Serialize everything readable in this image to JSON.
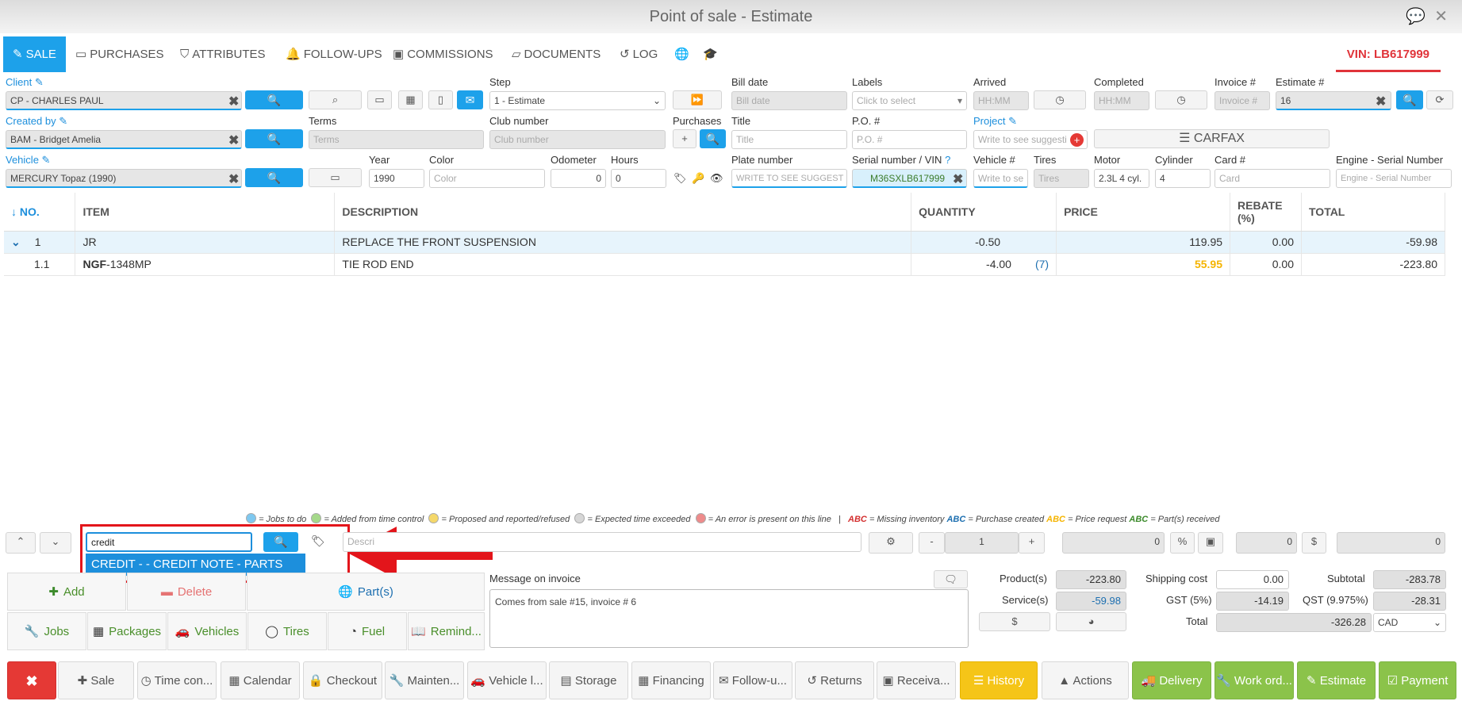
{
  "window": {
    "title": "Point of sale - Estimate"
  },
  "tabs": [
    "SALE",
    "PURCHASES",
    "ATTRIBUTES",
    "FOLLOW-UPS",
    "COMMISSIONS",
    "DOCUMENTS",
    "LOG"
  ],
  "vin_tab": "VIN: LB617999",
  "labels": {
    "client": "Client",
    "step": "Step",
    "bill_date": "Bill date",
    "labels": "Labels",
    "arrived": "Arrived",
    "completed": "Completed",
    "invoice": "Invoice #",
    "estimate": "Estimate #",
    "created_by": "Created by",
    "terms": "Terms",
    "club": "Club number",
    "purchases": "Purchases",
    "title": "Title",
    "po": "P.O. #",
    "project": "Project",
    "vehicle": "Vehicle",
    "year": "Year",
    "color": "Color",
    "odometer": "Odometer",
    "hours": "Hours",
    "plate": "Plate number",
    "serial": "Serial number / VIN",
    "vehicle_no": "Vehicle #",
    "tires": "Tires",
    "motor": "Motor",
    "cylinder": "Cylinder",
    "card": "Card #",
    "engine_serial": "Engine - Serial Number"
  },
  "fields": {
    "client": "CP - CHARLES PAUL",
    "step": "1 - Estimate",
    "bill_date_ph": "Bill date",
    "labels_ph": "Click to select",
    "arrived_ph": "HH:MM",
    "completed_ph": "HH:MM",
    "invoice_ph": "Invoice #",
    "estimate": "16",
    "created_by": "BAM - Bridget Amelia",
    "terms_ph": "Terms",
    "club_ph": "Club number",
    "title_ph": "Title",
    "po_ph": "P.O. #",
    "project_ph": "Write to see suggesti",
    "carfax": "CARFAX",
    "vehicle": "MERCURY Topaz (1990)",
    "year": "1990",
    "color_ph": "Color",
    "odometer": "0",
    "hours": "0",
    "plate_ph": "WRITE TO SEE SUGGEST",
    "serial": "M36SXLB617999",
    "vehicle_no_ph": "Write to se",
    "tires_ph": "Tires",
    "motor": "2.3L  4 cyl.",
    "cylinder": "4",
    "card_ph": "Card",
    "engine_ph": "Engine - Serial Number"
  },
  "table": {
    "headers": {
      "no": "↓ NO.",
      "item": "ITEM",
      "description": "DESCRIPTION",
      "quantity": "QUANTITY",
      "price": "PRICE",
      "rebate": "REBATE",
      "rebate2": "(%)",
      "total": "TOTAL"
    },
    "rows": [
      {
        "no": "1",
        "item": "JR",
        "item_bold": "",
        "description": "REPLACE THE FRONT SUSPENSION",
        "quantity": "-0.50",
        "qty_extra": "",
        "price": "119.95",
        "rebate": "0.00",
        "total": "-59.98"
      },
      {
        "no": "1.1",
        "item": "-1348MP",
        "item_bold": "NGF",
        "description": "TIE ROD END",
        "quantity": "-4.00",
        "qty_extra": "(7)",
        "price": "55.95",
        "rebate": "0.00",
        "total": "-223.80"
      }
    ]
  },
  "legend": {
    "jobs": "= Jobs to do",
    "added": "= Added from time control",
    "proposed": "= Proposed and reported/refused",
    "expected": "= Expected time exceeded",
    "error": "= An error is present on this line",
    "sep": "|",
    "abc": "ABC",
    "missing": "= Missing inventory",
    "purchase": "= Purchase created",
    "price_req": "= Price request",
    "received": "= Part(s) received",
    "colors": {
      "jobs": "#7ec8f0",
      "added": "#a5d98a",
      "proposed": "#f5d86a",
      "expected": "#d6d6d6",
      "error": "#ee8b8b"
    }
  },
  "entry": {
    "search_value": "credit",
    "suggestion": "CREDIT - - CREDIT NOTE - PARTS",
    "desc_ph": "Descri",
    "qty": "1",
    "price": "0",
    "rebate": "0",
    "total": "0",
    "minus": "-",
    "plus": "+",
    "percent": "%",
    "dollar": "$"
  },
  "actions": {
    "add": "Add",
    "delete": "Delete",
    "parts": "Part(s)",
    "jobs": "Jobs",
    "packages": "Packages",
    "vehicles": "Vehicles",
    "tires": "Tires",
    "fuel": "Fuel",
    "remind": "Remind..."
  },
  "message": {
    "label": "Message on invoice",
    "text": "Comes from sale #15, invoice # 6"
  },
  "totals": {
    "products_label": "Product(s)",
    "products": "-223.80",
    "services_label": "Service(s)",
    "services": "-59.98",
    "shipping_label": "Shipping cost",
    "shipping": "0.00",
    "gst_label": "GST (5%)",
    "gst": "-14.19",
    "subtotal_label": "Subtotal",
    "subtotal": "-283.78",
    "qst_label": "QST (9.975%)",
    "qst": "-28.31",
    "total_label": "Total",
    "total": "-326.28",
    "currency": "CAD",
    "dollar": "$"
  },
  "bottom": [
    "Sale",
    "Time con...",
    "Calendar",
    "Checkout",
    "Mainten...",
    "Vehicle l...",
    "Storage",
    "Financing",
    "Follow-u...",
    "Returns",
    "Receiva...",
    "History",
    "Actions",
    "Delivery",
    "Work ord...",
    "Estimate",
    "Payment"
  ]
}
